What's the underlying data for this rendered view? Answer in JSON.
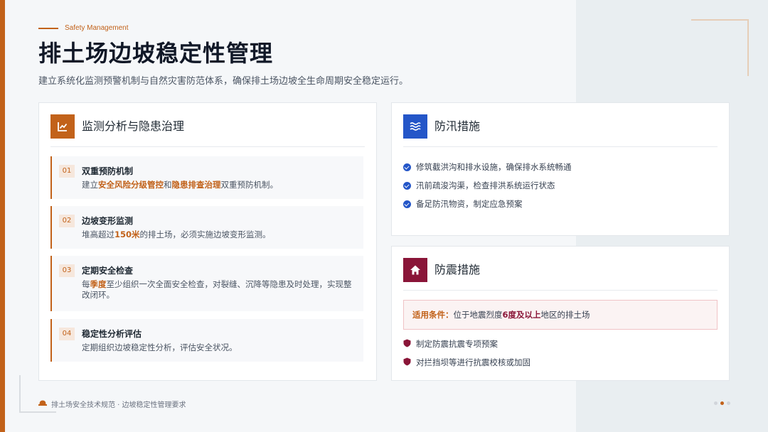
{
  "header": {
    "eyebrow": "Safety Management",
    "title": "排土场边坡稳定性管理",
    "subtitle": "建立系统化监测预警机制与自然灾害防范体系，确保排土场边坡全生命周期安全稳定运行。"
  },
  "monitoring": {
    "icon": "chart-line-icon",
    "title": "监测分析与隐患治理",
    "items": [
      {
        "num": "01",
        "title": "双重预防机制",
        "desc": [
          "建立",
          "安全风险分级管控",
          "和",
          "隐患排查治理",
          "双重预防机制。"
        ]
      },
      {
        "num": "02",
        "title": "边坡变形监测",
        "desc": [
          "堆高超过",
          "150米",
          "的排土场，必须实施边坡变形监测。"
        ]
      },
      {
        "num": "03",
        "title": "定期安全检查",
        "desc": [
          "每",
          "季度",
          "至少组织一次全面安全检查，对裂缝、沉降等隐患及时处理，实现整改闭环。"
        ]
      },
      {
        "num": "04",
        "title": "稳定性分析评估",
        "desc": [
          "定期组织边坡稳定性分析，评估安全状况。"
        ]
      }
    ]
  },
  "flood": {
    "icon": "waves-icon",
    "title": "防汛措施",
    "items": [
      "修筑截洪沟和排水设施，确保排水系统畅通",
      "汛前疏浚沟渠，检查排洪系统运行状态",
      "备足防汛物资，制定应急预案"
    ]
  },
  "quake": {
    "icon": "house-icon",
    "title": "防震措施",
    "condition_label": "适用条件：",
    "condition_pre": "位于地震烈度",
    "condition_em": "6度及以上",
    "condition_post": "地区的排土场",
    "items": [
      "制定防震抗震专项预案",
      "对拦挡坝等进行抗震校核或加固"
    ]
  },
  "footer": {
    "icon": "hardhat-icon",
    "text": "排土场安全技术规范 · 边坡稳定性管理要求"
  },
  "pagination": {
    "count": 3,
    "active": 2
  },
  "colors": {
    "accent": "#c2621a",
    "flood": "#2456c8",
    "quake": "#8a1538"
  }
}
